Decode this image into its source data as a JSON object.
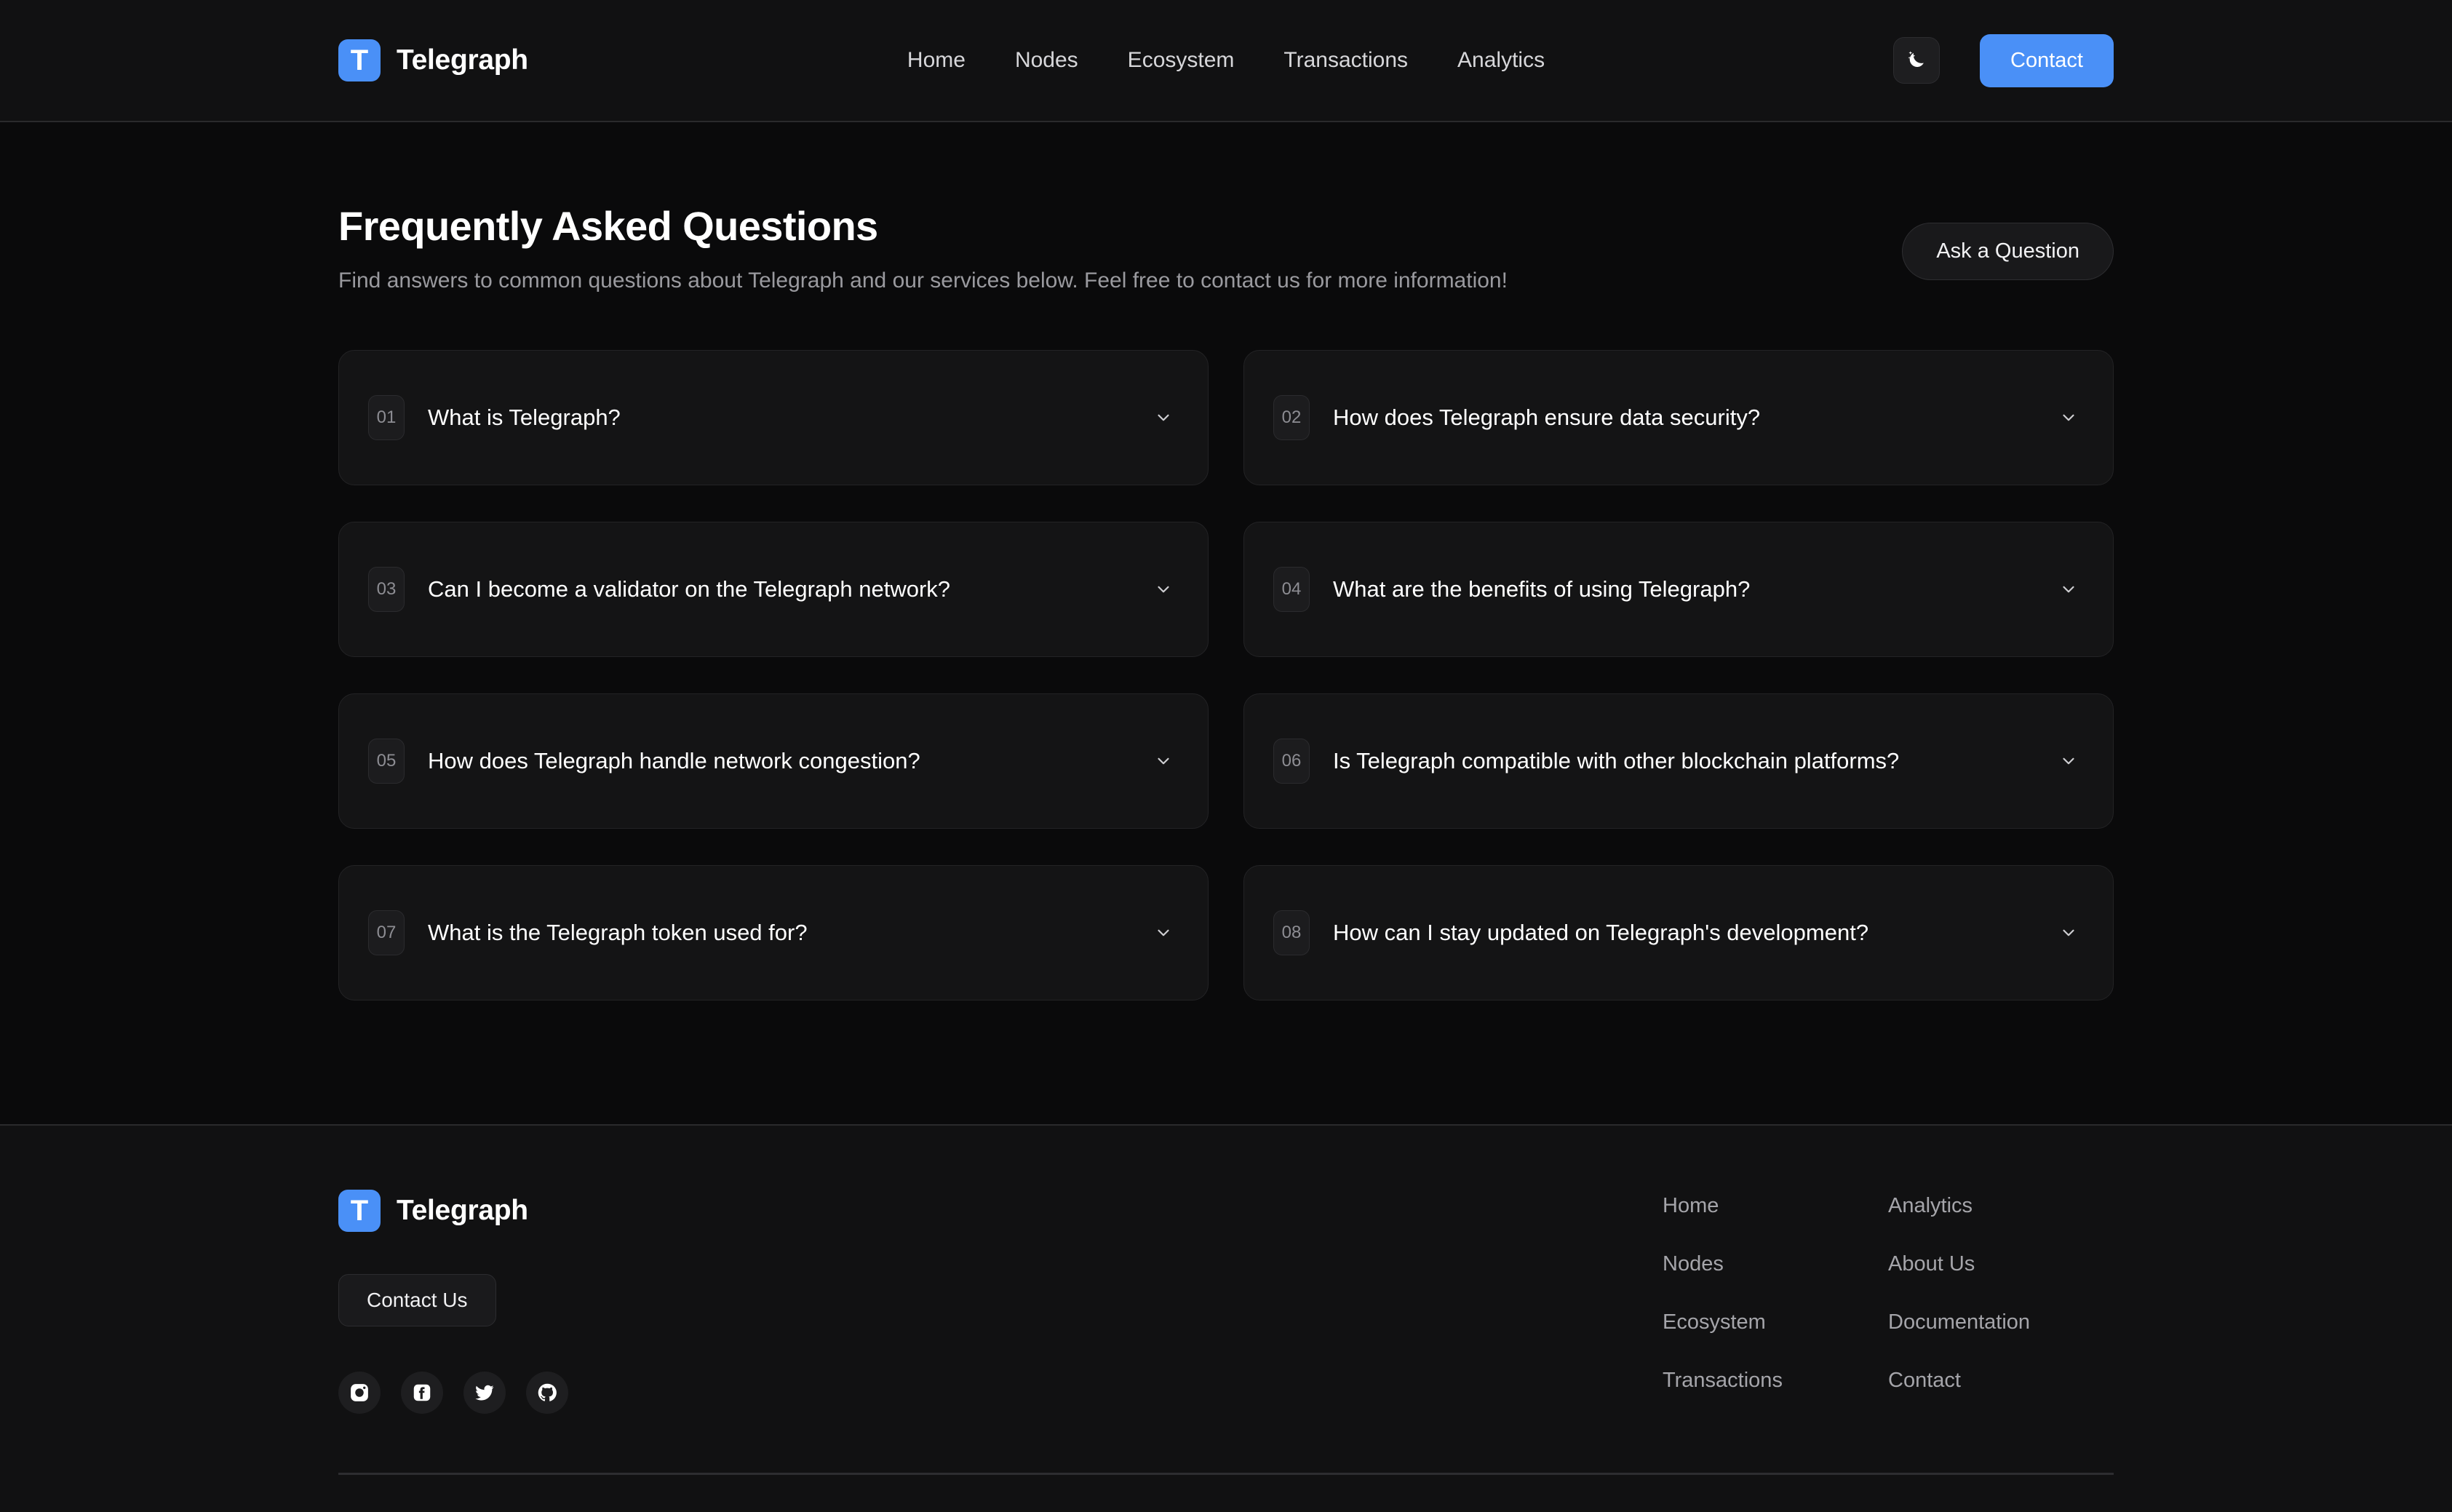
{
  "brand": {
    "logo_letter": "T",
    "name": "Telegraph"
  },
  "header": {
    "nav": [
      {
        "label": "Home"
      },
      {
        "label": "Nodes"
      },
      {
        "label": "Ecosystem"
      },
      {
        "label": "Transactions"
      },
      {
        "label": "Analytics"
      }
    ],
    "theme_toggle_icon": "moon-stars-icon",
    "contact_label": "Contact",
    "accent_color": "#4a90f7"
  },
  "faq": {
    "title": "Frequently Asked Questions",
    "subtitle": "Find answers to common questions about Telegraph and our services below. Feel free to contact us for more information!",
    "ask_label": "Ask a Question",
    "items": [
      {
        "num": "01",
        "question": "What is Telegraph?"
      },
      {
        "num": "02",
        "question": "How does Telegraph ensure data security?"
      },
      {
        "num": "03",
        "question": "Can I become a validator on the Telegraph network?"
      },
      {
        "num": "04",
        "question": "What are the benefits of using Telegraph?"
      },
      {
        "num": "05",
        "question": "How does Telegraph handle network congestion?"
      },
      {
        "num": "06",
        "question": "Is Telegraph compatible with other blockchain platforms?"
      },
      {
        "num": "07",
        "question": "What is the Telegraph token used for?"
      },
      {
        "num": "08",
        "question": "How can I stay updated on Telegraph's development?"
      }
    ]
  },
  "footer": {
    "contact_us_label": "Contact Us",
    "socials": [
      {
        "name": "instagram-icon"
      },
      {
        "name": "facebook-icon"
      },
      {
        "name": "twitter-icon"
      },
      {
        "name": "github-icon"
      }
    ],
    "columns": [
      {
        "links": [
          {
            "label": "Home"
          },
          {
            "label": "Nodes"
          },
          {
            "label": "Ecosystem"
          },
          {
            "label": "Transactions"
          }
        ]
      },
      {
        "links": [
          {
            "label": "Analytics"
          },
          {
            "label": "About Us"
          },
          {
            "label": "Documentation"
          },
          {
            "label": "Contact"
          }
        ]
      }
    ]
  }
}
